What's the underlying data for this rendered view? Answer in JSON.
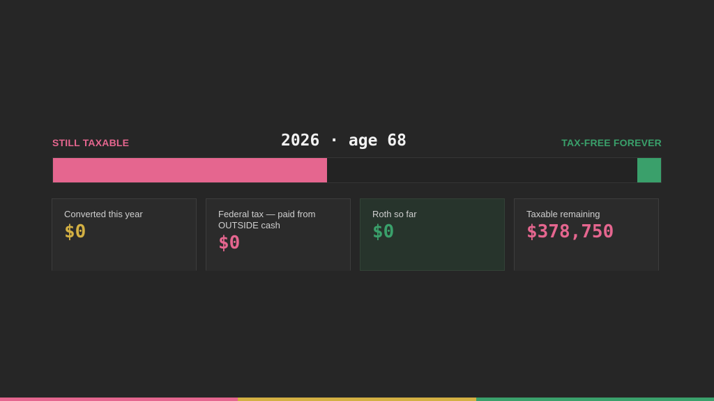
{
  "header": {
    "left_label": "STILL TAXABLE",
    "title": "2026 · age 68",
    "right_label": "TAX-FREE FOREVER"
  },
  "progress": {
    "taxable_fraction": 0.451,
    "roth_fraction": 0.039
  },
  "cards": [
    {
      "label": "Converted this year",
      "value": "$0"
    },
    {
      "label": "Federal tax — paid from OUTSIDE cash",
      "value": "$0"
    },
    {
      "label": "Roth so far",
      "value": "$0"
    },
    {
      "label": "Taxable remaining",
      "value": "$378,750"
    }
  ],
  "colors": {
    "taxable": "#e5668f",
    "tax_free": "#3aa06b",
    "converted": "#d3b043",
    "background": "#262626"
  }
}
